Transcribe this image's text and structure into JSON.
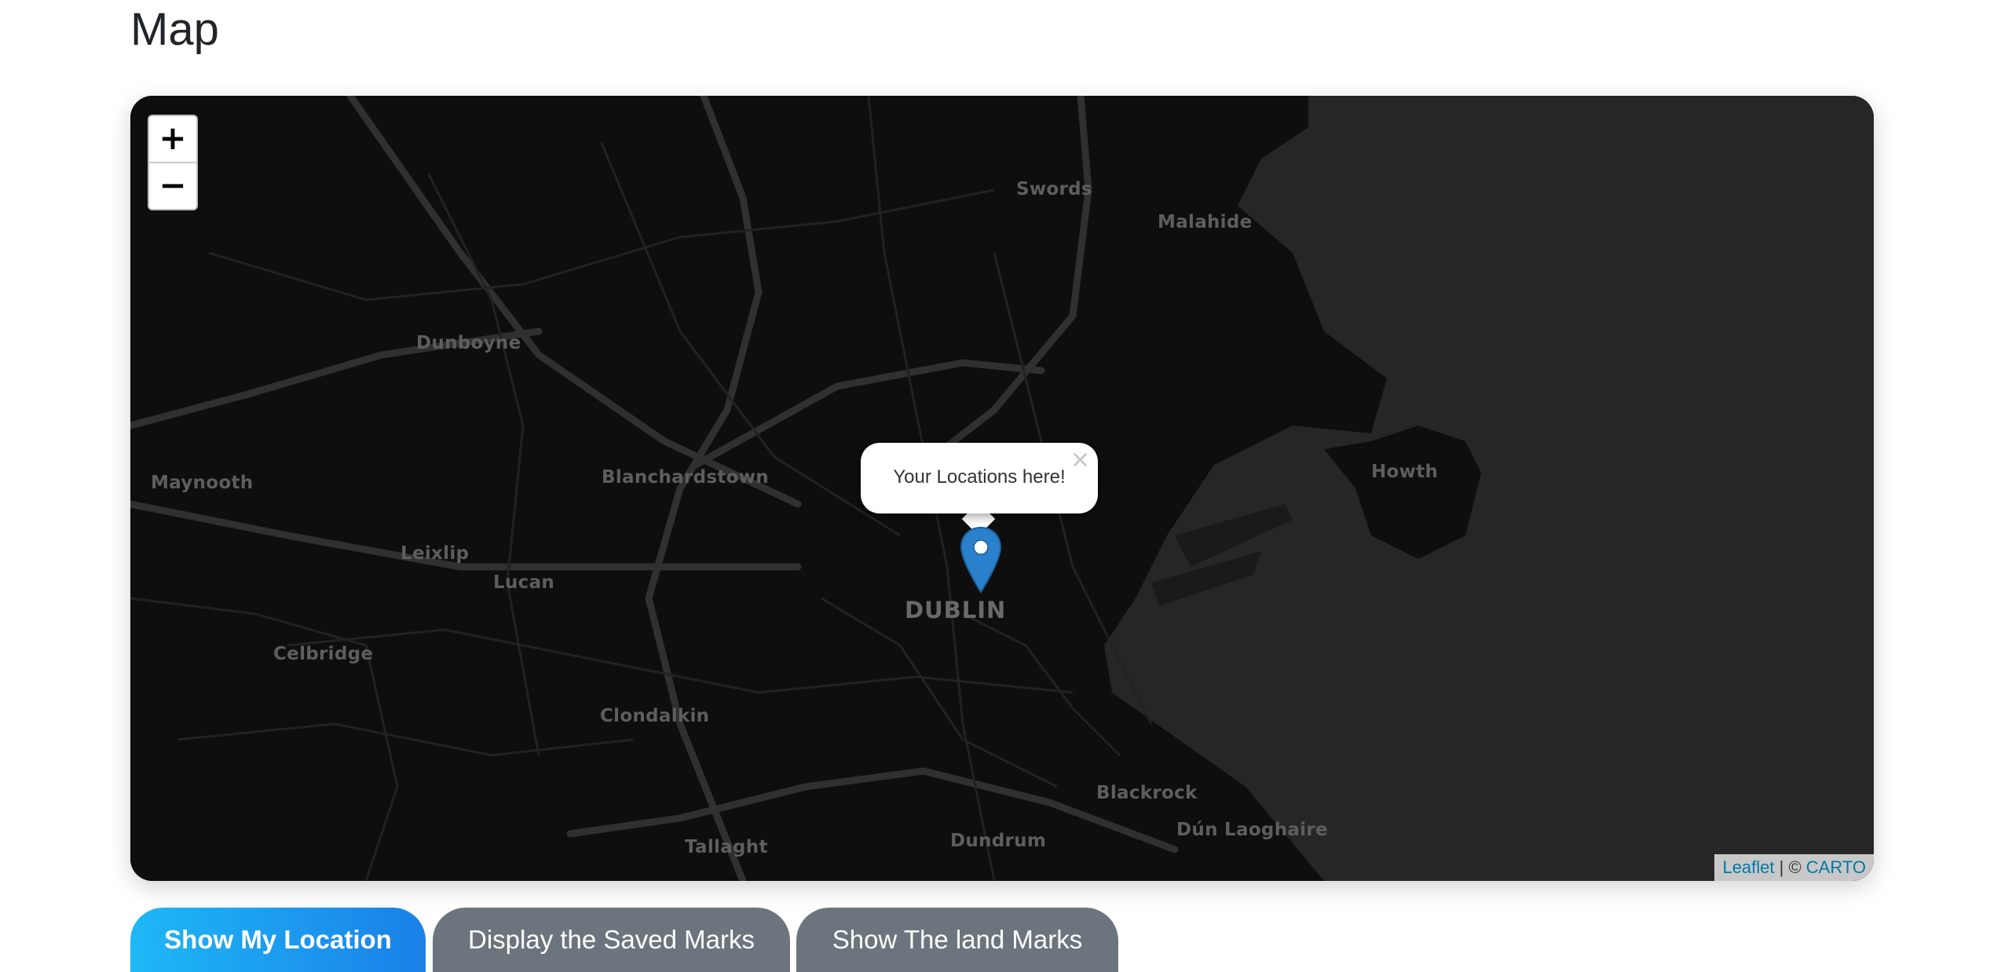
{
  "page": {
    "title": "Map"
  },
  "map": {
    "zoom_in_label": "+",
    "zoom_out_label": "−",
    "places": {
      "swords": "Swords",
      "malahide": "Malahide",
      "dunboyne": "Dunboyne",
      "maynooth": "Maynooth",
      "blanchardstown": "Blanchardstown",
      "howth": "Howth",
      "leixlip": "Leixlip",
      "lucan": "Lucan",
      "dublin": "DUBLIN",
      "celbridge": "Celbridge",
      "clondalkin": "Clondalkin",
      "blackrock": "Blackrock",
      "dun_laoghaire": "Dún Laoghaire",
      "dundrum": "Dundrum",
      "tallaght": "Tallaght"
    },
    "popup": {
      "text": "Your Locations here!",
      "close": "×"
    },
    "attribution": {
      "leaflet": "Leaflet",
      "separator": " | © ",
      "carto": "CARTO"
    },
    "colors": {
      "land": "#0e0e0e",
      "sea": "#262626",
      "roads": "#2c2c2c",
      "marker": "#2a81cb"
    }
  },
  "buttons": {
    "show_location": "Show My Location",
    "saved_marks": "Display the Saved Marks",
    "land_marks": "Show The land Marks"
  }
}
